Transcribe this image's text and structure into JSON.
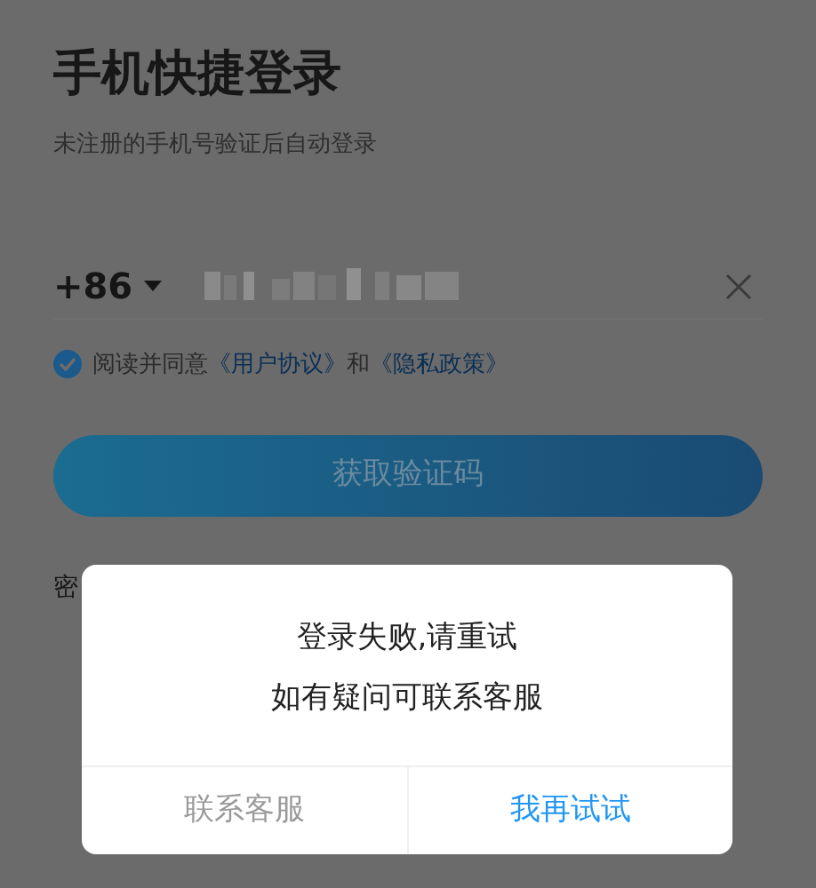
{
  "title": "手机快捷登录",
  "subtitle": "未注册的手机号验证后自动登录",
  "phone": {
    "country_code": "+86"
  },
  "agreement": {
    "checked": true,
    "parts": [
      {
        "kind": "text",
        "text": "阅读并同意"
      },
      {
        "kind": "link",
        "text": "《用户协议》"
      },
      {
        "kind": "text",
        "text": "和"
      },
      {
        "kind": "link",
        "text": "《隐私政策》"
      }
    ]
  },
  "primary_button": "获取验证码",
  "partial_label": "密",
  "dialog": {
    "lines": [
      "登录失败,请重试",
      "如有疑问可联系客服"
    ],
    "buttons": [
      {
        "label": "联系客服",
        "kind": "secondary"
      },
      {
        "label": "我再试试",
        "kind": "primary"
      }
    ]
  }
}
